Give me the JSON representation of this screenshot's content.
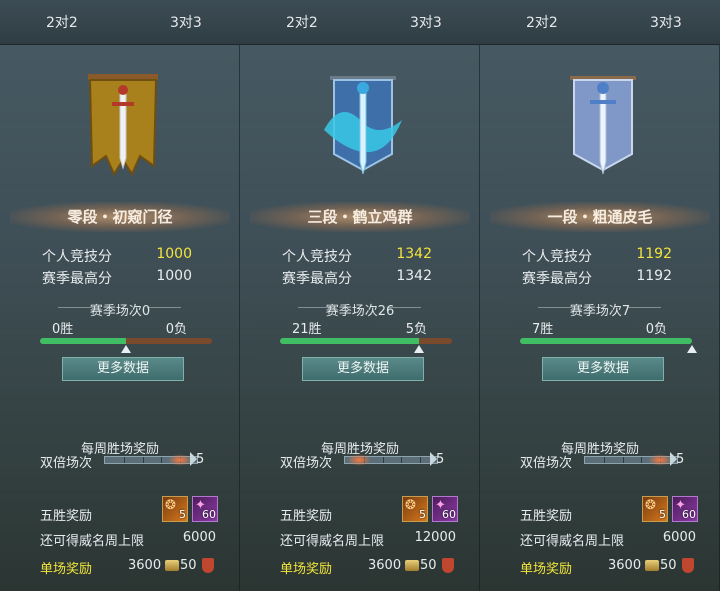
{
  "panels": [
    {
      "tabs": [
        "2对2",
        "3对3"
      ],
      "emblem": "blue-dragon-sword-banner-icon",
      "rank": "三段・鹤立鸡群",
      "personal_label": "个人竞技分",
      "personal_score": "1342",
      "season_best_label": "赛季最高分",
      "season_best": "1342",
      "season_matches": "赛季场次26",
      "wins": "21胜",
      "losses": "5负",
      "win_fraction": 0.808,
      "more_data": "更多数据",
      "weekly_reward": "每周胜场奖励",
      "double_label": "双倍场次",
      "double_count": "5",
      "double_glow_fraction": 0.15,
      "five_win_label": "五胜奖励",
      "item1_qty": "5",
      "item2_qty": "60",
      "weekly_cap_label": "还可得威名周上限",
      "weekly_cap": "12000",
      "single_reward_label": "单场奖励",
      "single_coin": "3600",
      "single_honor": "50"
    },
    {
      "tabs": [
        "2对2",
        "3对3"
      ],
      "emblem": "silver-sword-banner-icon",
      "rank": "一段・粗通皮毛",
      "personal_label": "个人竞技分",
      "personal_score": "1192",
      "season_best_label": "赛季最高分",
      "season_best": "1192",
      "season_matches": "赛季场次7",
      "wins": "7胜",
      "losses": "0负",
      "win_fraction": 1.0,
      "more_data": "更多数据",
      "weekly_reward": "每周胜场奖励",
      "double_label": "双倍场次",
      "double_count": "5",
      "double_glow_fraction": 0.8,
      "five_win_label": "五胜奖励",
      "item1_qty": "5",
      "item2_qty": "60",
      "weekly_cap_label": "还可得威名周上限",
      "weekly_cap": "6000",
      "single_reward_label": "单场奖励",
      "single_coin": "3600",
      "single_honor": "50"
    },
    {
      "tabs": [
        "2对2",
        "3对3"
      ],
      "emblem": "bronze-sword-banner-icon",
      "rank": "零段・初窥门径",
      "personal_label": "个人竞技分",
      "personal_score": "1000",
      "season_best_label": "赛季最高分",
      "season_best": "1000",
      "season_matches": "赛季场次0",
      "wins": "0胜",
      "losses": "0负",
      "win_fraction": 0.5,
      "more_data": "更多数据",
      "weekly_reward": "每周胜场奖励",
      "double_label": "双倍场次",
      "double_count": "5",
      "double_glow_fraction": 0.8,
      "five_win_label": "五胜奖励",
      "item1_qty": "5",
      "item2_qty": "60",
      "weekly_cap_label": "还可得威名周上限",
      "weekly_cap": "6000",
      "single_reward_label": "单场奖励",
      "single_coin": "3600",
      "single_honor": "50"
    }
  ],
  "colors": {
    "highlight": "#f3e43c",
    "win_bar": "#3fbe63",
    "loss_bar": "#7a4a2c"
  }
}
